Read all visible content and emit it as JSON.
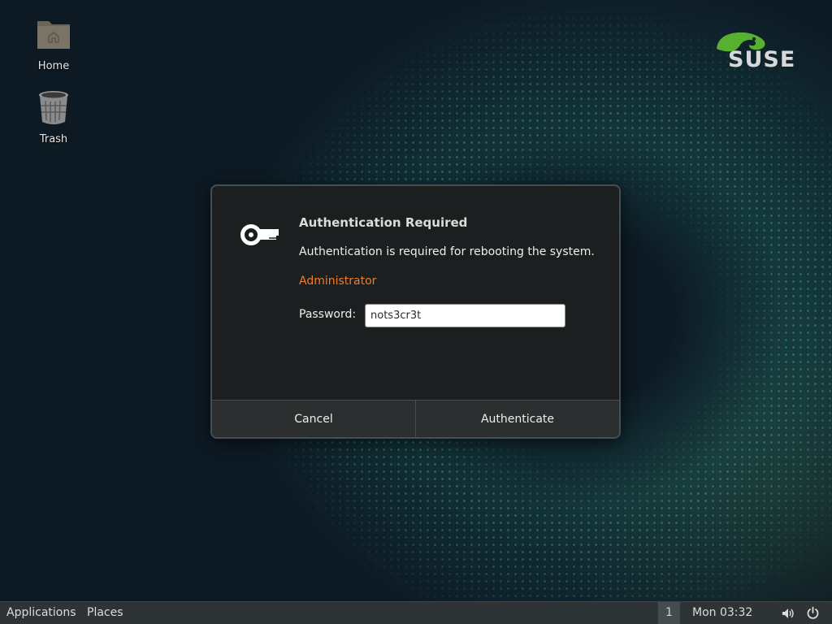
{
  "desktop": {
    "icons": [
      {
        "label": "Home",
        "icon": "folder-home-icon"
      },
      {
        "label": "Trash",
        "icon": "trash-icon"
      }
    ],
    "logo": {
      "text": "SUSE",
      "icon": "chameleon-icon",
      "color": "#58b031"
    }
  },
  "dialog": {
    "title": "Authentication Required",
    "message": "Authentication is required for rebooting the system.",
    "user": "Administrator",
    "password_label": "Password:",
    "password_value": "nots3cr3t",
    "cancel_label": "Cancel",
    "authenticate_label": "Authenticate",
    "icon": "key-icon",
    "user_color": "#f47c21"
  },
  "panel": {
    "applications_label": "Applications",
    "places_label": "Places",
    "workspace": "1",
    "clock": "Mon 03:32",
    "icons": [
      "volume-icon",
      "power-icon"
    ]
  }
}
